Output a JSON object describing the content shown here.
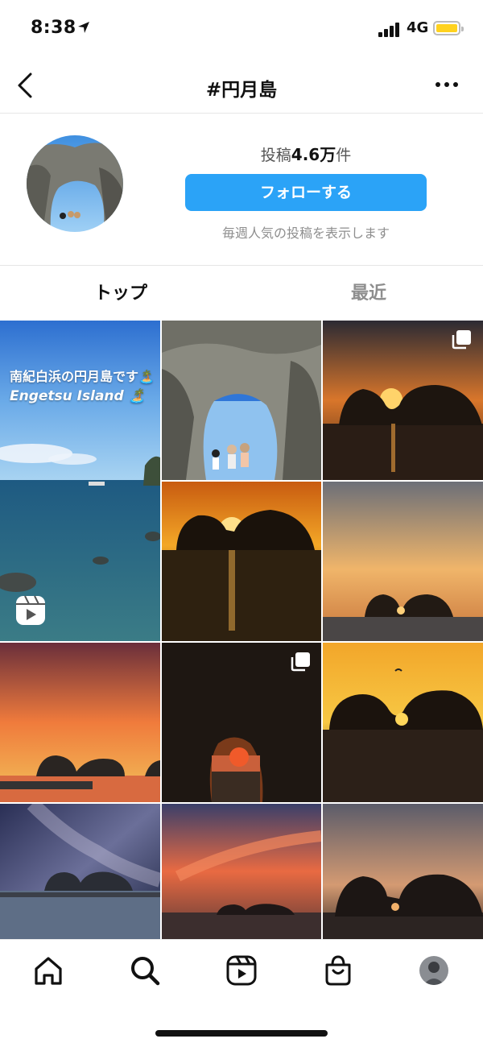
{
  "status_bar": {
    "time": "8:38",
    "network": "4G"
  },
  "header": {
    "title": "#円月島"
  },
  "profile": {
    "posts_label": "投稿",
    "posts_count": "4.6万",
    "posts_unit": "件",
    "follow_label": "フォローする",
    "subtitle": "毎週人気の投稿を表示します"
  },
  "tabs": [
    {
      "label": "トップ",
      "active": true
    },
    {
      "label": "最近",
      "active": false
    }
  ],
  "grid": {
    "post1_line1": "南紀白浜の円月島です🏝️",
    "post1_line2": "Engetsu Island 🏝️"
  },
  "colors": {
    "accent": "#2ba3f7",
    "battery": "#ffd21f"
  },
  "bottom_nav": [
    "home-icon",
    "search-icon",
    "reels-icon",
    "shop-icon",
    "profile-avatar"
  ]
}
